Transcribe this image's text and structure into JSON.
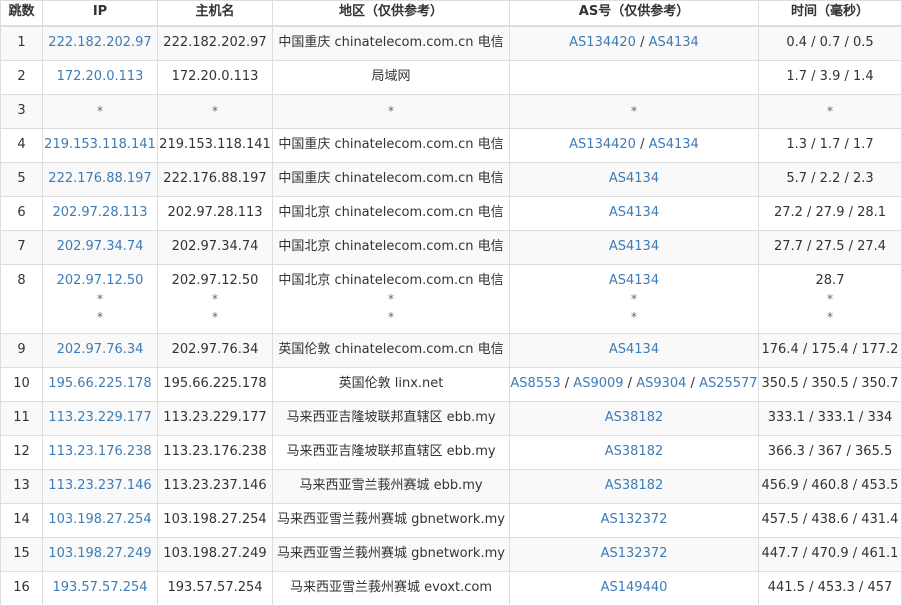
{
  "colors": {
    "link": "#3e7cb5",
    "text": "#333333",
    "border": "#dddddd",
    "stripe": "#f9f9f9"
  },
  "table": {
    "headers": {
      "hop": "跳数",
      "ip": "IP",
      "host": "主机名",
      "region": "地区（仅供参考）",
      "as": "AS号（仅供参考）",
      "time": "时间（毫秒）"
    },
    "rows": [
      {
        "hop": "1",
        "ip": "222.182.202.97",
        "host": "222.182.202.97",
        "region": "中国重庆 chinatelecom.com.cn 电信",
        "as": [
          "AS134420",
          "AS4134"
        ],
        "time": "0.4 / 0.7 / 0.5"
      },
      {
        "hop": "2",
        "ip": "172.20.0.113",
        "host": "172.20.0.113",
        "region": "局域网",
        "as": [],
        "time": "1.7 / 3.9 / 1.4"
      },
      {
        "hop": "3",
        "ip": "*",
        "host": "*",
        "region": "*",
        "as_text": "*",
        "time": "*"
      },
      {
        "hop": "4",
        "ip": "219.153.118.141",
        "host": "219.153.118.141",
        "region": "中国重庆 chinatelecom.com.cn 电信",
        "as": [
          "AS134420",
          "AS4134"
        ],
        "time": "1.3 / 1.7 / 1.7"
      },
      {
        "hop": "5",
        "ip": "222.176.88.197",
        "host": "222.176.88.197",
        "region": "中国重庆 chinatelecom.com.cn 电信",
        "as": [
          "AS4134"
        ],
        "time": "5.7 / 2.2 / 2.3"
      },
      {
        "hop": "6",
        "ip": "202.97.28.113",
        "host": "202.97.28.113",
        "region": "中国北京 chinatelecom.com.cn 电信",
        "as": [
          "AS4134"
        ],
        "time": "27.2 / 27.9 / 28.1"
      },
      {
        "hop": "7",
        "ip": "202.97.34.74",
        "host": "202.97.34.74",
        "region": "中国北京 chinatelecom.com.cn 电信",
        "as": [
          "AS4134"
        ],
        "time": "27.7 / 27.5 / 27.4"
      },
      {
        "hop": "8",
        "ip": "202.97.12.50",
        "host": "202.97.12.50",
        "region": "中国北京 chinatelecom.com.cn 电信",
        "as": [
          "AS4134"
        ],
        "time": "28.7",
        "extra_lines": [
          "*",
          "*"
        ]
      },
      {
        "hop": "9",
        "ip": "202.97.76.34",
        "host": "202.97.76.34",
        "region": "英国伦敦 chinatelecom.com.cn 电信",
        "as": [
          "AS4134"
        ],
        "time": "176.4 / 175.4 / 177.2"
      },
      {
        "hop": "10",
        "ip": "195.66.225.178",
        "host": "195.66.225.178",
        "region": "英国伦敦 linx.net",
        "as": [
          "AS8553",
          "AS9009",
          "AS9304",
          "AS25577"
        ],
        "time": "350.5 / 350.5 / 350.7"
      },
      {
        "hop": "11",
        "ip": "113.23.229.177",
        "host": "113.23.229.177",
        "region": "马来西亚吉隆坡联邦直辖区 ebb.my",
        "as": [
          "AS38182"
        ],
        "time": "333.1 / 333.1 / 334"
      },
      {
        "hop": "12",
        "ip": "113.23.176.238",
        "host": "113.23.176.238",
        "region": "马来西亚吉隆坡联邦直辖区 ebb.my",
        "as": [
          "AS38182"
        ],
        "time": "366.3 / 367 / 365.5"
      },
      {
        "hop": "13",
        "ip": "113.23.237.146",
        "host": "113.23.237.146",
        "region": "马来西亚雪兰莪州赛城 ebb.my",
        "as": [
          "AS38182"
        ],
        "time": "456.9 / 460.8 / 453.5"
      },
      {
        "hop": "14",
        "ip": "103.198.27.254",
        "host": "103.198.27.254",
        "region": "马来西亚雪兰莪州赛城 gbnetwork.my",
        "as": [
          "AS132372"
        ],
        "time": "457.5 / 438.6 / 431.4"
      },
      {
        "hop": "15",
        "ip": "103.198.27.249",
        "host": "103.198.27.249",
        "region": "马来西亚雪兰莪州赛城 gbnetwork.my",
        "as": [
          "AS132372"
        ],
        "time": "447.7 / 470.9 / 461.1"
      },
      {
        "hop": "16",
        "ip": "193.57.57.254",
        "host": "193.57.57.254",
        "region": "马来西亚雪兰莪州赛城 evoxt.com",
        "as": [
          "AS149440"
        ],
        "time": "441.5 / 453.3 / 457"
      }
    ],
    "as_separator": " / "
  }
}
